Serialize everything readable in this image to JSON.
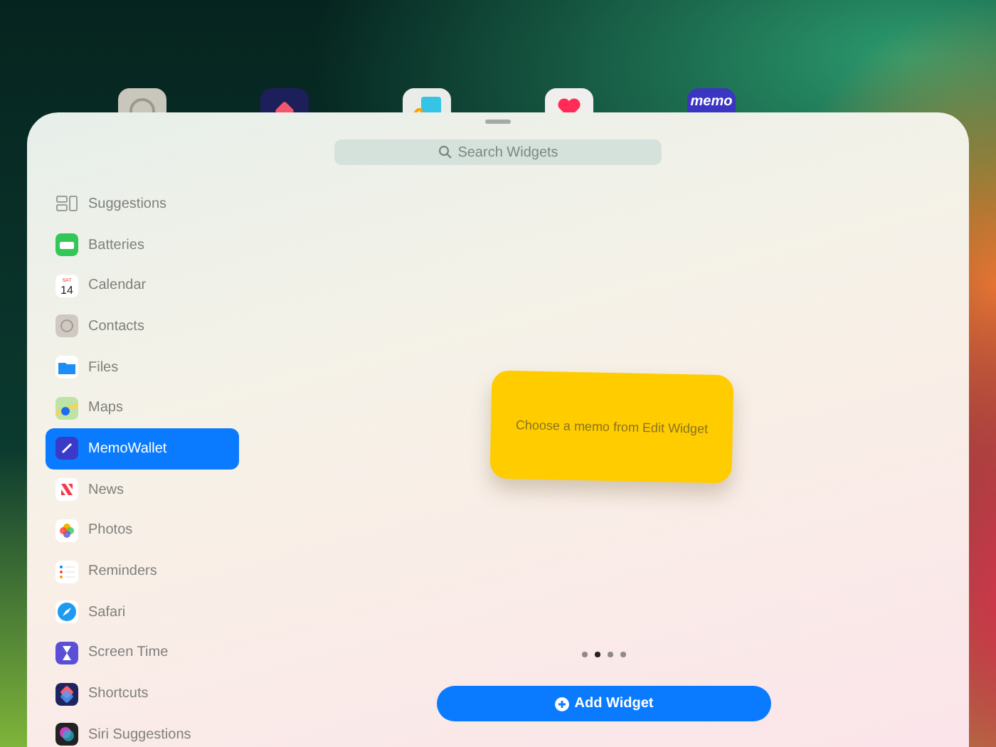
{
  "home_icons": [
    {
      "kind": "contacts"
    },
    {
      "kind": "shortcuts"
    },
    {
      "kind": "freeform"
    },
    {
      "kind": "health"
    },
    {
      "kind": "memo",
      "label": "memo"
    }
  ],
  "search": {
    "placeholder": "Search Widgets"
  },
  "sidebar": {
    "items": [
      {
        "kind": "suggestions",
        "label": "Suggestions",
        "selected": false
      },
      {
        "kind": "batteries",
        "label": "Batteries",
        "selected": false
      },
      {
        "kind": "calendar",
        "label": "Calendar",
        "selected": false,
        "day": "SAT",
        "date": "14"
      },
      {
        "kind": "contacts",
        "label": "Contacts",
        "selected": false
      },
      {
        "kind": "files",
        "label": "Files",
        "selected": false
      },
      {
        "kind": "maps",
        "label": "Maps",
        "selected": false
      },
      {
        "kind": "memo",
        "label": "MemoWallet",
        "selected": true
      },
      {
        "kind": "news",
        "label": "News",
        "selected": false
      },
      {
        "kind": "photos",
        "label": "Photos",
        "selected": false
      },
      {
        "kind": "reminders",
        "label": "Reminders",
        "selected": false
      },
      {
        "kind": "safari",
        "label": "Safari",
        "selected": false
      },
      {
        "kind": "screentime",
        "label": "Screen Time",
        "selected": false
      },
      {
        "kind": "shortcuts",
        "label": "Shortcuts",
        "selected": false
      },
      {
        "kind": "siri",
        "label": "Siri Suggestions",
        "selected": false
      }
    ]
  },
  "widget": {
    "message": "Choose a memo from Edit Widget"
  },
  "pages": [
    {
      "selected": false
    },
    {
      "selected": true
    },
    {
      "selected": false
    },
    {
      "selected": false
    }
  ],
  "add_button": {
    "label": "Add Widget"
  }
}
